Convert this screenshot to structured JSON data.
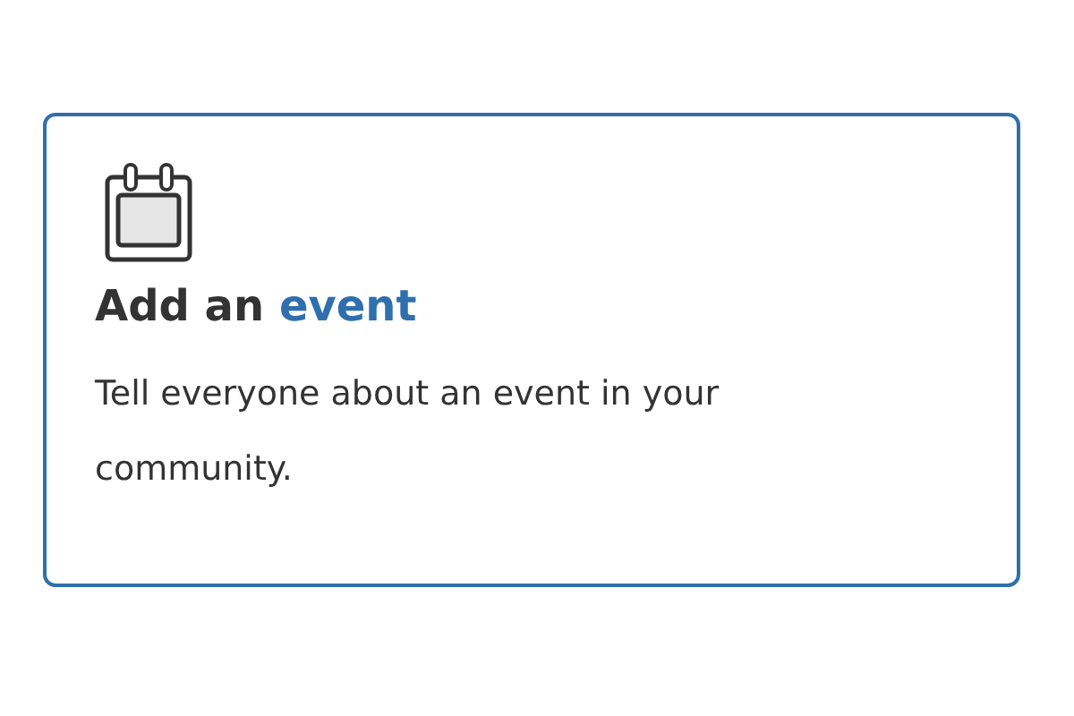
{
  "card": {
    "title": {
      "lead": "Add an",
      "accent": "event"
    },
    "description": "Tell everyone about an event in your community."
  }
}
